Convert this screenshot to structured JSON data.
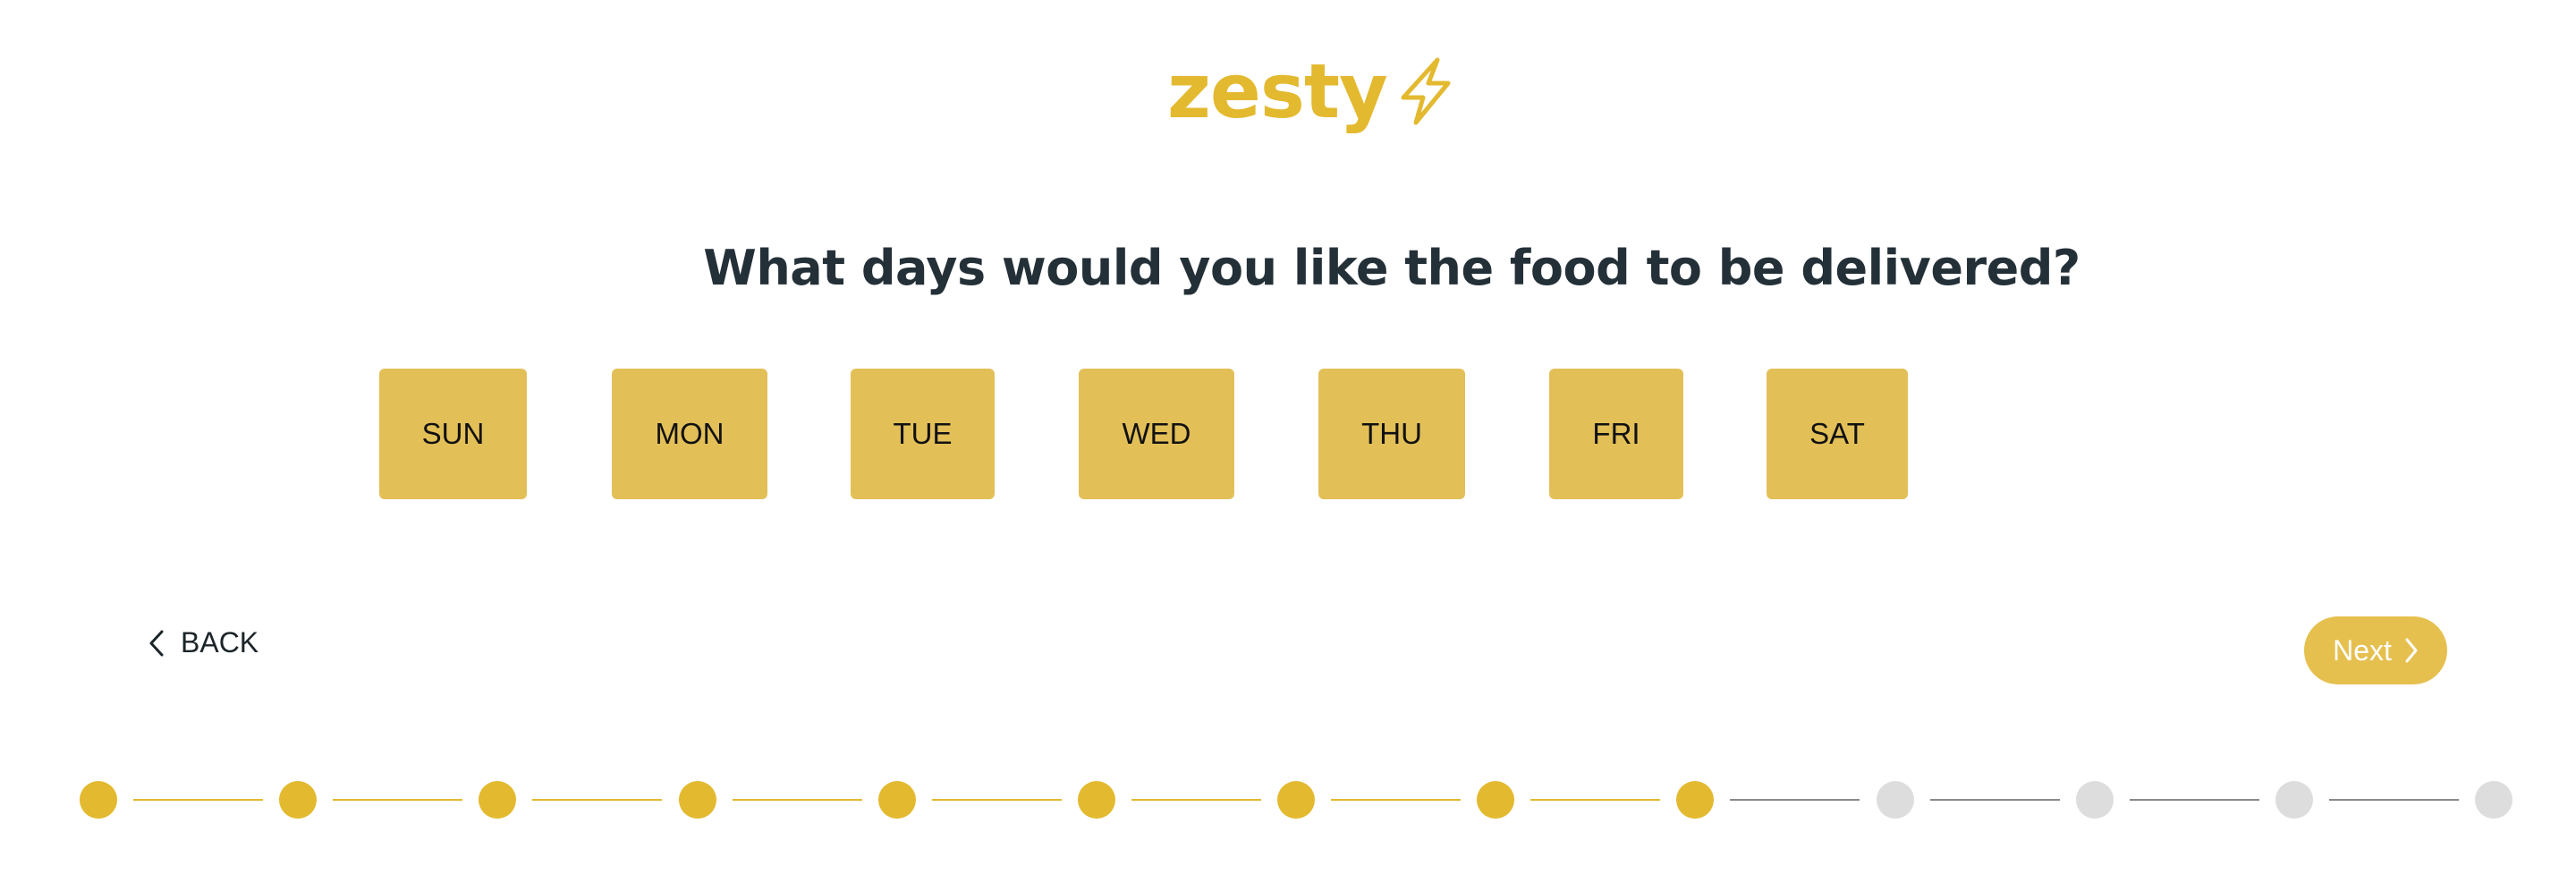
{
  "logo": {
    "text": "zesty"
  },
  "question": "What days would you like the food to be delivered?",
  "days": [
    "SUN",
    "MON",
    "TUE",
    "WED",
    "THU",
    "FRI",
    "SAT"
  ],
  "nav": {
    "back_label": "BACK",
    "next_label": "Next"
  },
  "progress": {
    "current_step": 9,
    "total_steps": 13,
    "active_color": "#e3b92f",
    "inactive_color": "#dddddd"
  },
  "colors": {
    "brand": "#e3b92f",
    "day_button": "#e3bf58",
    "heading": "#243038"
  }
}
